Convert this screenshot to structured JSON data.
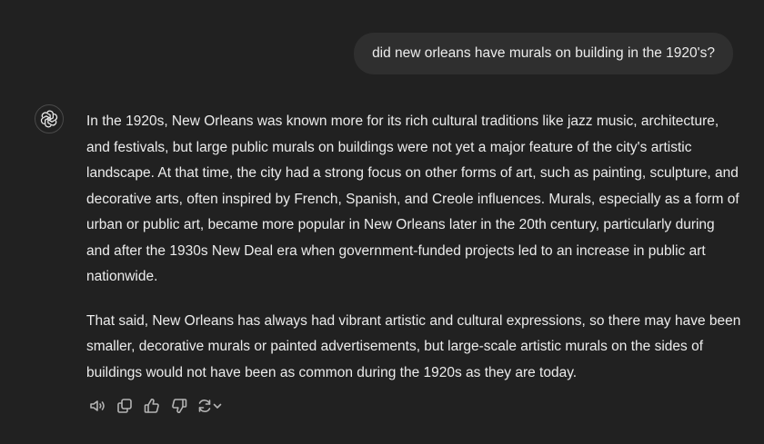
{
  "conversation": {
    "user_message": "did new orleans have murals on building in the 1920's?",
    "assistant_paragraphs": [
      "In the 1920s, New Orleans was known more for its rich cultural traditions like jazz music, architecture, and festivals, but large public murals on buildings were not yet a major feature of the city's artistic landscape. At that time, the city had a strong focus on other forms of art, such as painting, sculpture, and decorative arts, often inspired by French, Spanish, and Creole influences. Murals, especially as a form of urban or public art, became more popular in New Orleans later in the 20th century, particularly during and after the 1930s New Deal era when government-funded projects led to an increase in public art nationwide.",
      "That said, New Orleans has always had vibrant artistic and cultural expressions, so there may have been smaller, decorative murals or painted advertisements, but large-scale artistic murals on the sides of buildings would not have been as common during the 1920s as they are today."
    ]
  },
  "action_icons": [
    "speaker-icon",
    "copy-icon",
    "thumbs-up-icon",
    "thumbs-down-icon",
    "regenerate-icon",
    "chevron-down-icon"
  ],
  "colors": {
    "background": "#212121",
    "user_bubble": "#2f2f2f",
    "text": "#ececec",
    "icon": "#b4b4b4"
  }
}
